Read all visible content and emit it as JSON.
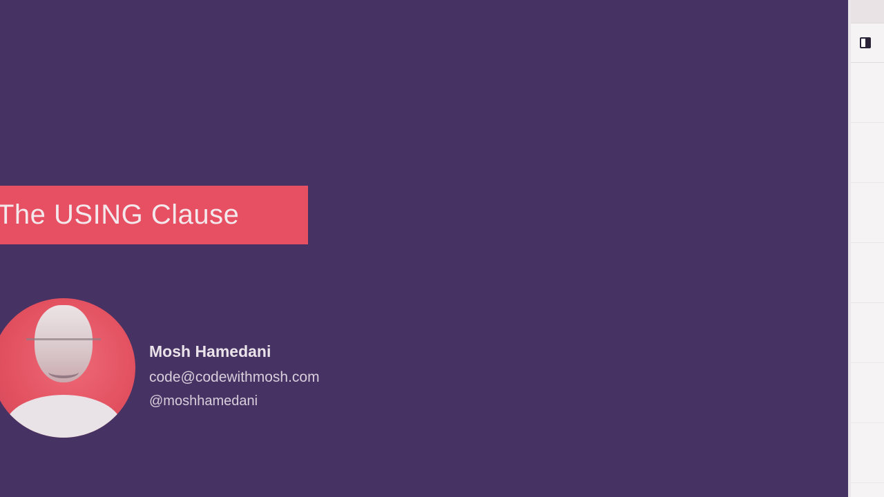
{
  "slide": {
    "title": "The USING Clause",
    "presenter": {
      "name": "Mosh Hamedani",
      "email": "code@codewithmosh.com",
      "handle": "@moshhamedani"
    }
  },
  "colors": {
    "background": "#463263",
    "banner": "#e74f63",
    "text": "#f3e8ec",
    "side_panel": "#f6f3f5"
  },
  "side_panel": {
    "icon": "panel-toggle-icon"
  }
}
